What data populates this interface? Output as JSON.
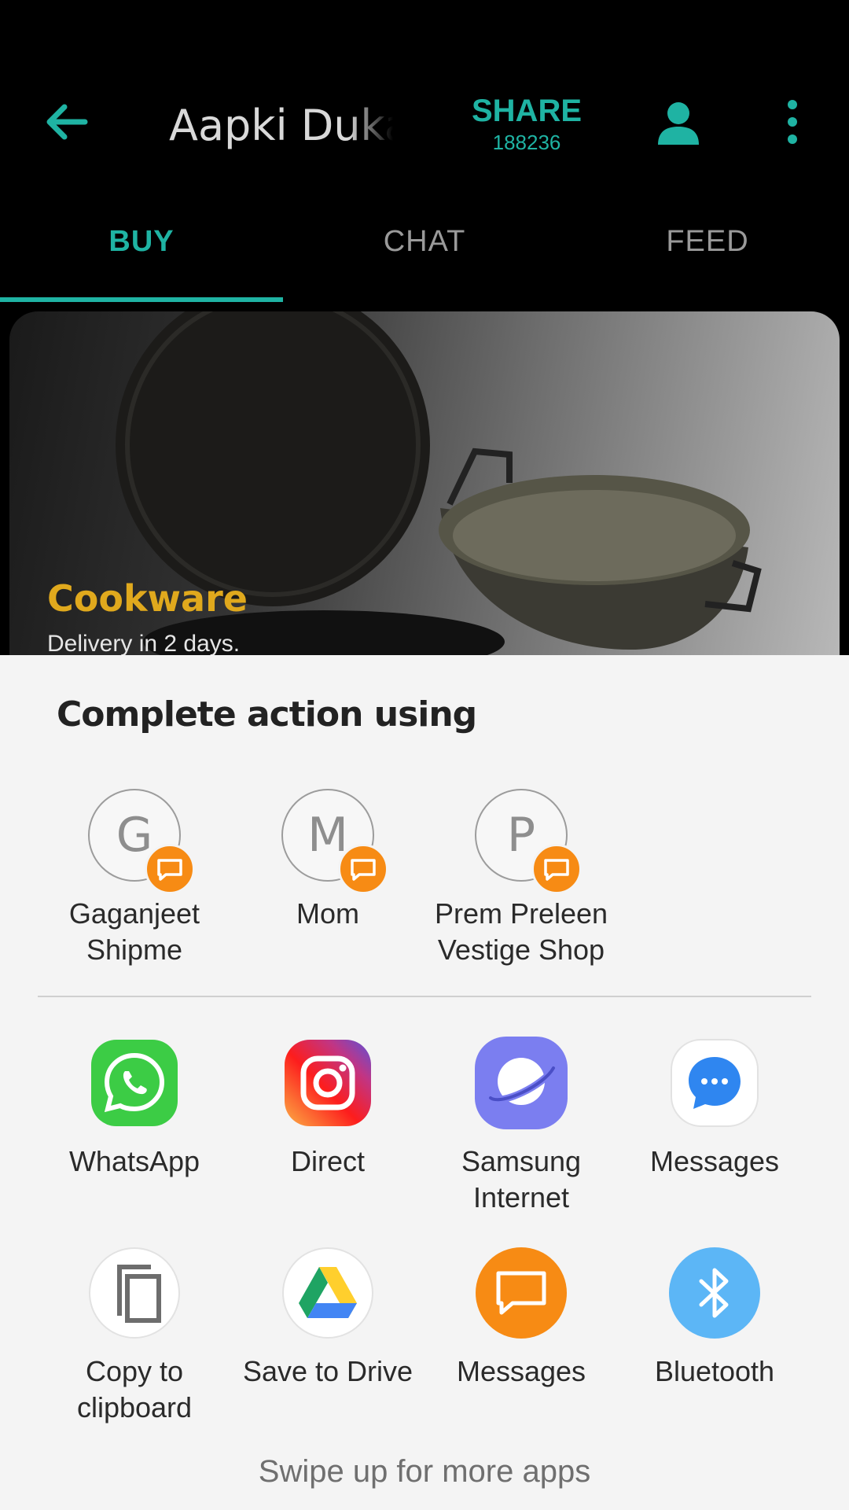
{
  "appbar": {
    "title": "Aapki Dukan",
    "share_label": "SHARE",
    "share_count": "188236",
    "icons": {
      "back": "arrow-left-icon",
      "profile": "person-icon",
      "more": "more-vert-icon"
    },
    "accent": "#1fb3a3"
  },
  "tabs": [
    {
      "label": "BUY",
      "active": true
    },
    {
      "label": "CHAT",
      "active": false
    },
    {
      "label": "FEED",
      "active": false
    }
  ],
  "banner": {
    "title": "Cookware",
    "subtitle": "Delivery in 2 days."
  },
  "sheet": {
    "title": "Complete action using",
    "contacts": [
      {
        "initial": "G",
        "name": "Gaganjeet\nShipme"
      },
      {
        "initial": "M",
        "name": "Mom"
      },
      {
        "initial": "P",
        "name": "Prem Preleen\nVestige Shop"
      }
    ],
    "apps": [
      {
        "label": "WhatsApp",
        "icon": "whatsapp-icon"
      },
      {
        "label": "Direct",
        "icon": "instagram-icon"
      },
      {
        "label": "Samsung\nInternet",
        "icon": "samsung-internet-icon"
      },
      {
        "label": "Messages",
        "icon": "messages-icon"
      },
      {
        "label": "Copy to\nclipboard",
        "icon": "copy-icon"
      },
      {
        "label": "Save to Drive",
        "icon": "google-drive-icon"
      },
      {
        "label": "Messages",
        "icon": "chat-bubble-icon"
      },
      {
        "label": "Bluetooth",
        "icon": "bluetooth-icon"
      }
    ],
    "swipe_hint": "Swipe up for more apps"
  }
}
